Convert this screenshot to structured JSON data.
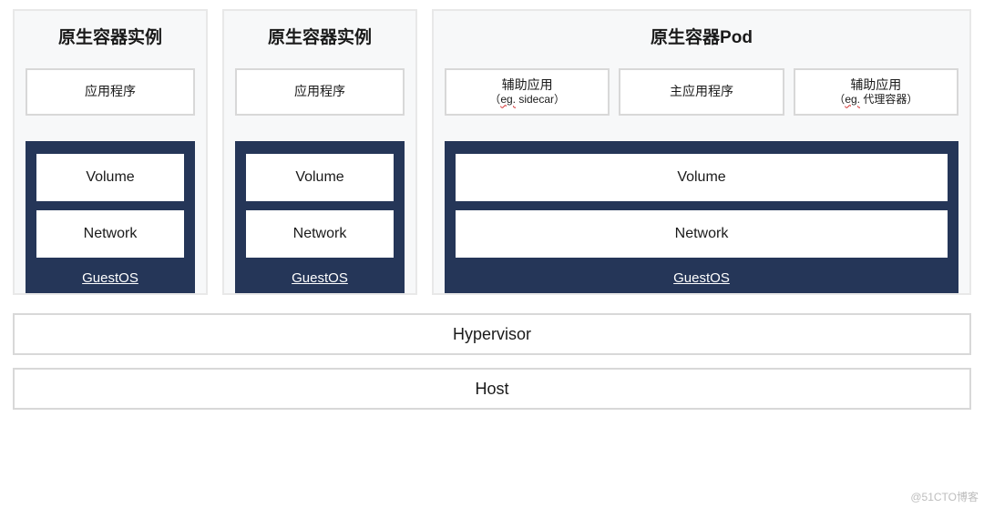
{
  "containers": [
    {
      "title": "原生容器实例",
      "apps": [
        {
          "main": "应用程序",
          "sub": ""
        }
      ],
      "volume": "Volume",
      "network": "Network",
      "guestos": "GuestOS"
    },
    {
      "title": "原生容器实例",
      "apps": [
        {
          "main": "应用程序",
          "sub": ""
        }
      ],
      "volume": "Volume",
      "network": "Network",
      "guestos": "GuestOS"
    },
    {
      "title": "原生容器Pod",
      "apps": [
        {
          "main": "辅助应用",
          "sub_prefix": "（",
          "sub_wavy": "eg.",
          "sub_suffix": " sidecar）"
        },
        {
          "main": "主应用程序",
          "sub": ""
        },
        {
          "main": "辅助应用",
          "sub_prefix": "（",
          "sub_wavy": "eg.",
          "sub_suffix": " 代理容器）"
        }
      ],
      "volume": "Volume",
      "network": "Network",
      "guestos": "GuestOS"
    }
  ],
  "hypervisor": "Hypervisor",
  "host": "Host",
  "watermark": "@51CTO博客"
}
